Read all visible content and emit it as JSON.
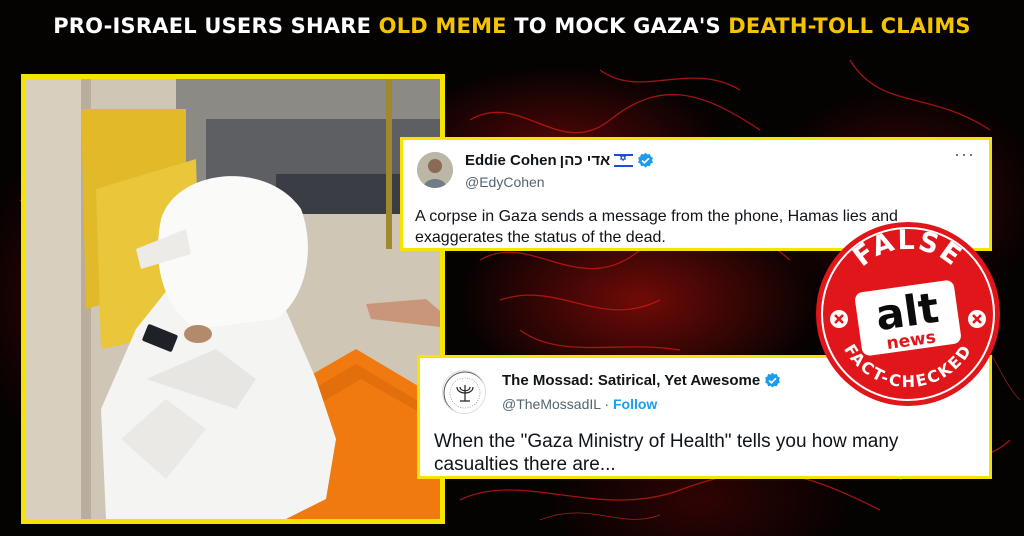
{
  "headline": {
    "part1": "PRO-ISRAEL USERS SHARE ",
    "highlight1": "OLD MEME",
    "part2": " TO MOCK GAZA'S ",
    "highlight2": "DEATH-TOLL CLAIMS"
  },
  "colors": {
    "accent_yellow": "#f5e400",
    "headline_highlight": "#f5c400",
    "stamp_red": "#e0161b",
    "verified_blue": "#1d9bf0"
  },
  "tweets": [
    {
      "name": "Eddie Cohen",
      "name_extra": "אדי כהן",
      "flag_icon": "israel-flag-icon",
      "verified": true,
      "handle": "@EdyCohen",
      "text": "A corpse in Gaza sends a message from the phone, Hamas lies and exaggerates the status of the dead.",
      "more_icon": "more-options-icon"
    },
    {
      "name": "The Mossad: Satirical, Yet Awesome",
      "verified": true,
      "handle": "@TheMossadIL",
      "separator": " · ",
      "follow_label": "Follow",
      "text": "When the \"Gaza Ministry of Health\" tells you how many casualties there are..."
    }
  ],
  "stamp": {
    "top_text": "FALSE",
    "logo_top": "alt",
    "logo_bottom": "news",
    "bottom_text": "FACT-CHECKED"
  }
}
